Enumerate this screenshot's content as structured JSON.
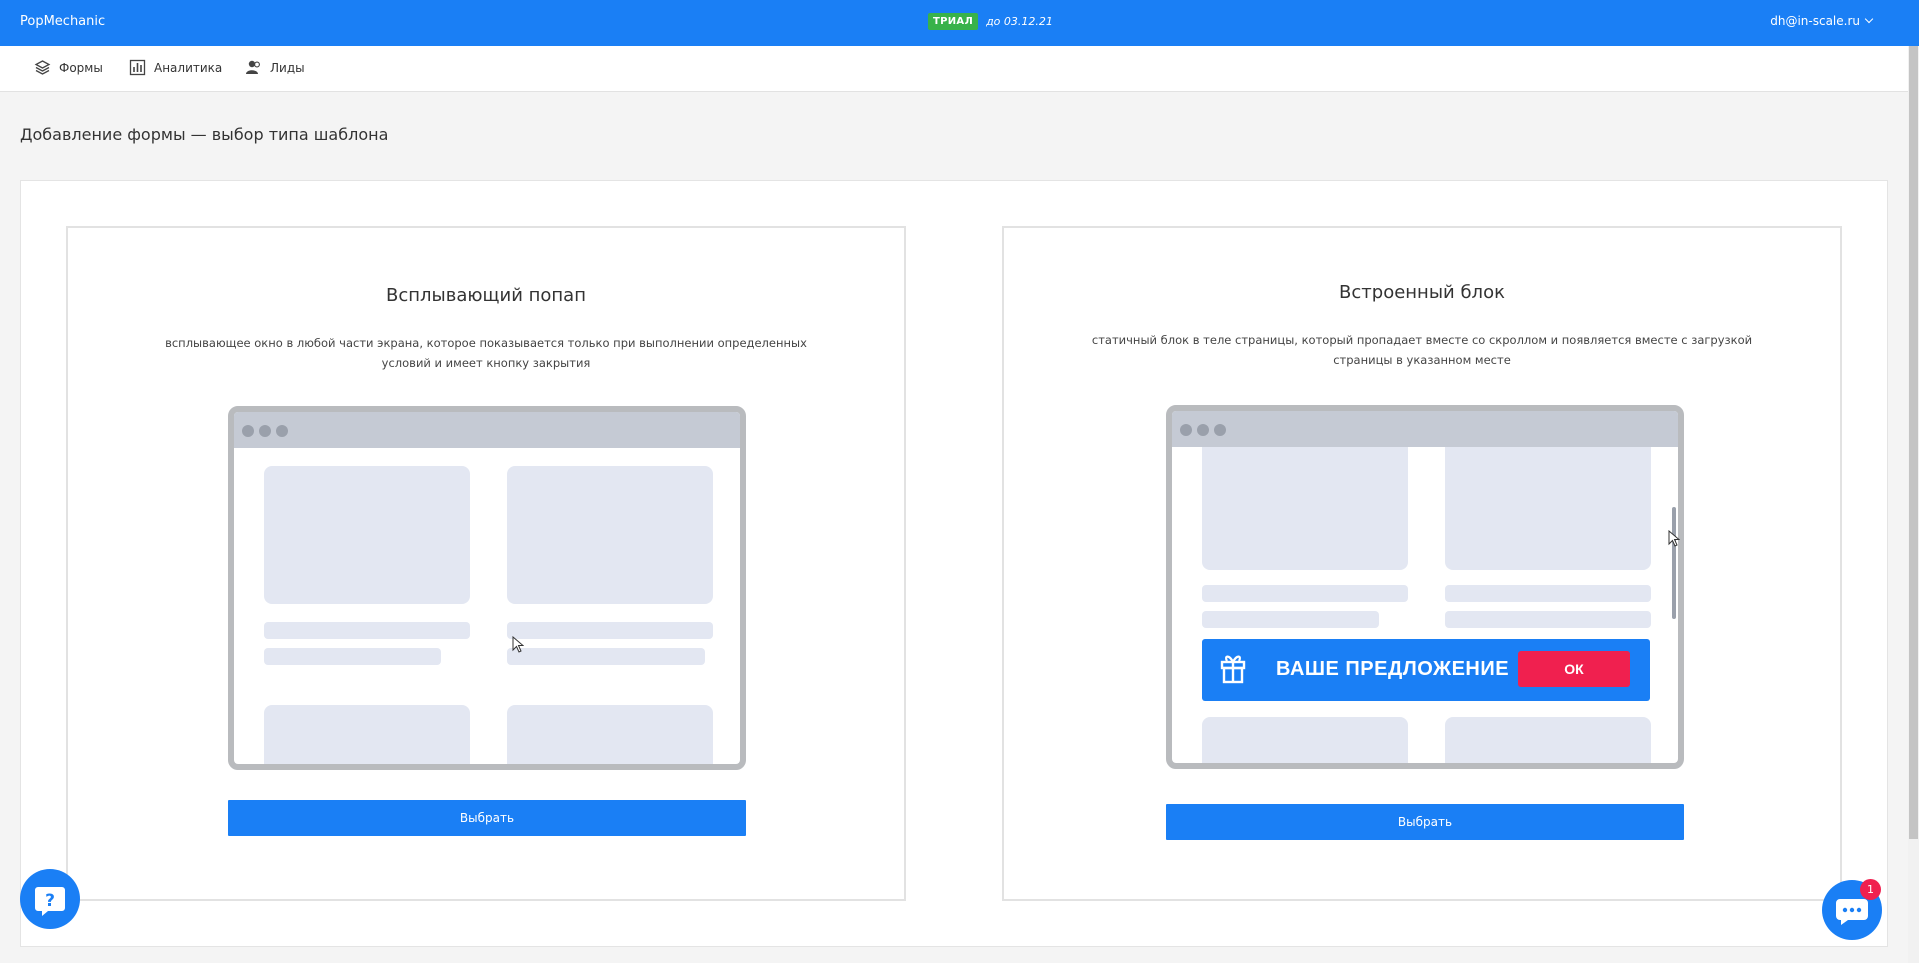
{
  "app": {
    "brand": "PopMechanic",
    "trial_badge": "ТРИАЛ",
    "trial_until": "до 03.12.21",
    "user_email": "dh@in-scale.ru"
  },
  "nav": {
    "items": [
      {
        "label": "Формы",
        "icon": "layers-icon"
      },
      {
        "label": "Аналитика",
        "icon": "chart-icon"
      },
      {
        "label": "Лиды",
        "icon": "users-icon"
      }
    ]
  },
  "page": {
    "title": "Добавление формы — выбор типа шаблона"
  },
  "templates": [
    {
      "title": "Всплывающий попап",
      "description": "всплывающее окно в любой части экрана, которое показывается только при выполнении определенных условий и имеет кнопку закрытия",
      "button": "Выбрать"
    },
    {
      "title": "Встроенный блок",
      "description": "статичный блок в теле страницы, который пропадает вместе со скроллом и появляется вместе с загрузкой страницы в указанном месте",
      "button": "Выбрать",
      "banner": {
        "text": "ВАШЕ ПРЕДЛОЖЕНИЕ",
        "ok": "ОК"
      }
    }
  ],
  "chat": {
    "unread": "1"
  },
  "colors": {
    "accent": "#1a7ff5",
    "trial": "#38b24a",
    "alert": "#f0204f"
  }
}
